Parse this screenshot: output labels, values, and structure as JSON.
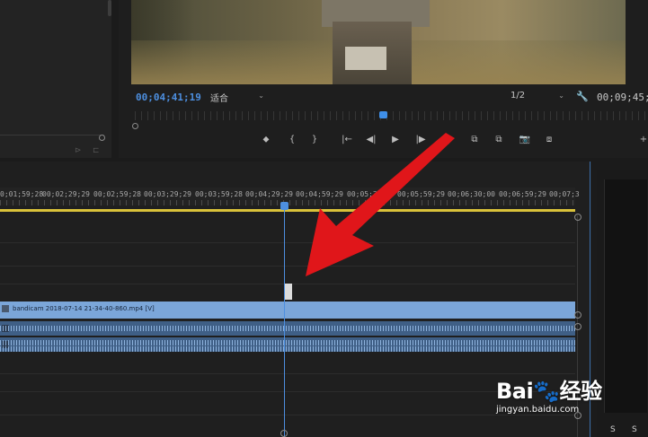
{
  "program_monitor": {
    "current_timecode": "00;04;41;19",
    "fit_value": "适合",
    "resolution_value": "1/2",
    "duration_timecode": "00;09;45;1"
  },
  "icons": {
    "wrench": "🔧",
    "marker": "⬥",
    "mark_in": "{",
    "mark_out": "}",
    "go_to_in": "|←",
    "step_back": "◀|",
    "play": "▶",
    "step_forward": "|▶",
    "go_to_out": "→|",
    "lift": "⧉",
    "extract": "⧉",
    "export_frame": "📷",
    "compare": "⧈",
    "add": "+",
    "left_panel_a": "⊳",
    "left_panel_b": "⊏"
  },
  "timeline": {
    "ruler_labels": [
      "0;01;59;28",
      "00;02;29;29",
      "00;02;59;28",
      "00;03;29;29",
      "00;03;59;28",
      "00;04;29;29",
      "00;04;59;29",
      "00;05;30;00",
      "00;05;59;29",
      "00;06;30;00",
      "00;06;59;29",
      "00;07;3"
    ],
    "video_clip_label": "bandicam 2018-07-14 21-34-40-860.mp4 [V]"
  },
  "audio_meters": {
    "solo_left": "S",
    "solo_right": "S"
  },
  "watermark": {
    "logo": "Bai🐾经验",
    "url": "jingyan.baidu.com"
  },
  "colors": {
    "accent_blue": "#4d8fe0",
    "video_clip": "#7ba6d9",
    "audio_clip": "#3f5f86",
    "work_area": "#d9c23a",
    "arrow_red": "#e0161a"
  }
}
